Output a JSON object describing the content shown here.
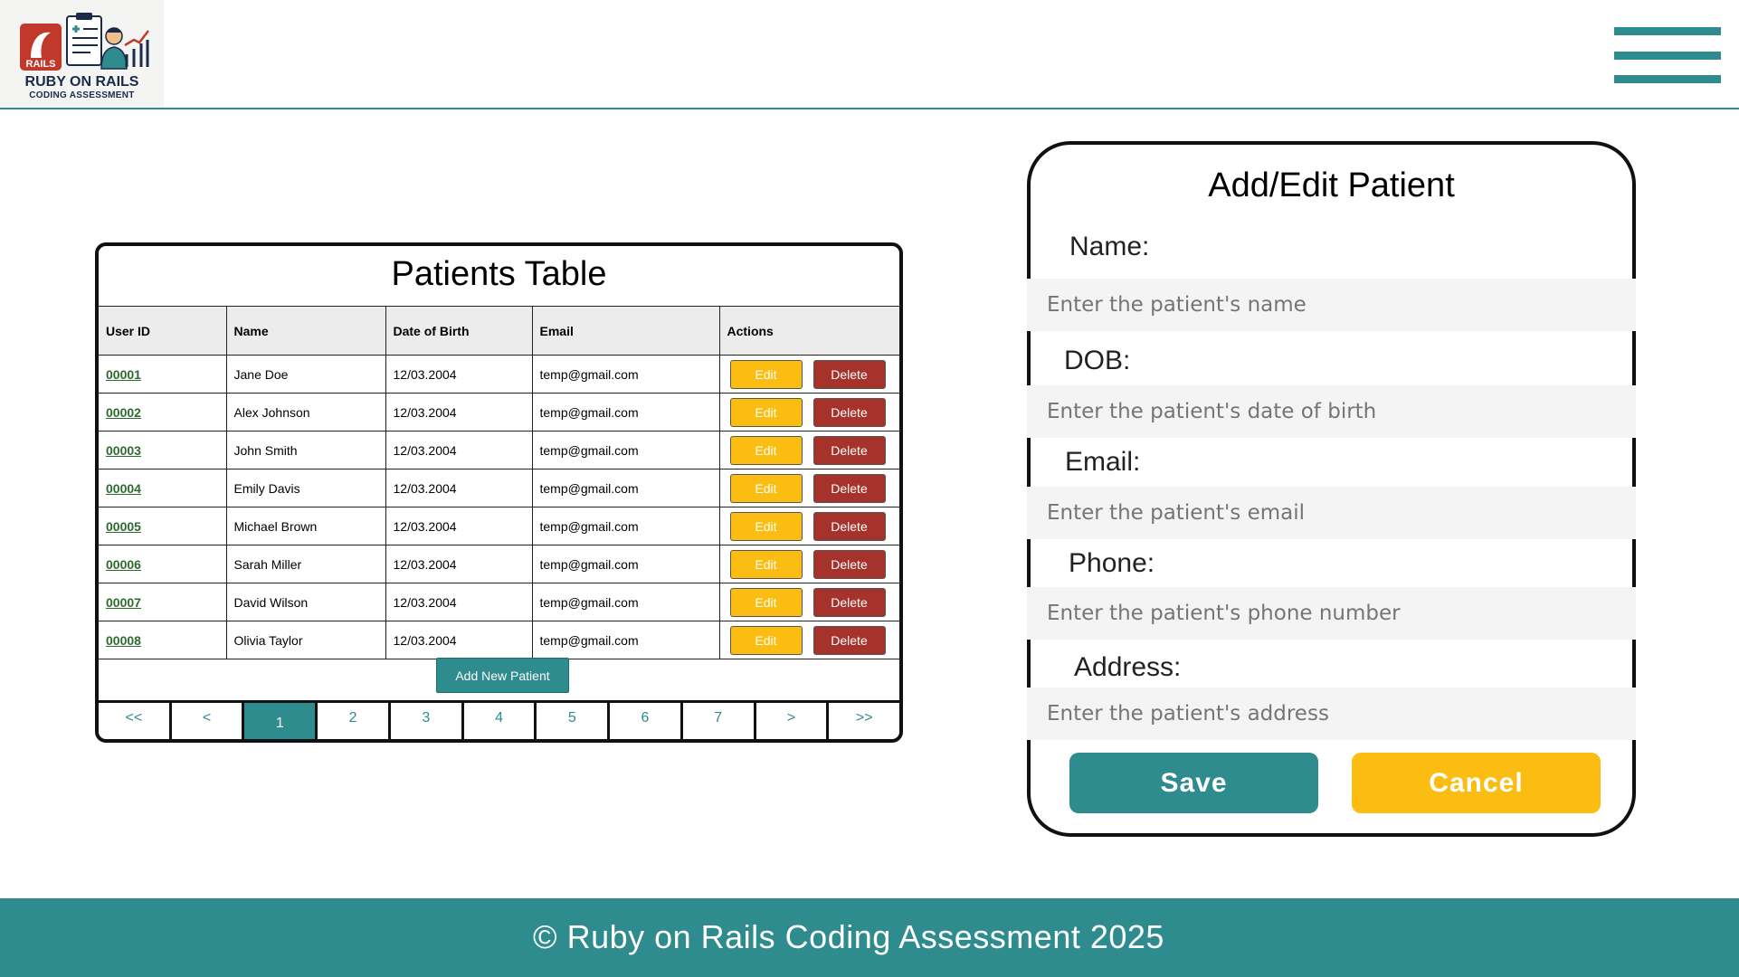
{
  "header": {
    "logo_badge": "RAILS",
    "logo_title": "RUBY ON RAILS",
    "logo_subtitle": "CODING ASSESSMENT",
    "menu_icon": "hamburger-menu-icon"
  },
  "table": {
    "title": "Patients Table",
    "columns": [
      "User ID",
      "Name",
      "Date of Birth",
      "Email",
      "Actions"
    ],
    "edit_label": "Edit",
    "delete_label": "Delete",
    "rows": [
      {
        "id": "00001",
        "name": "Jane Doe",
        "dob": "12/03.2004",
        "email": "temp@gmail.com"
      },
      {
        "id": "00002",
        "name": "Alex Johnson",
        "dob": "12/03.2004",
        "email": "temp@gmail.com"
      },
      {
        "id": "00003",
        "name": "John Smith",
        "dob": "12/03.2004",
        "email": "temp@gmail.com"
      },
      {
        "id": "00004",
        "name": "Emily Davis",
        "dob": "12/03.2004",
        "email": "temp@gmail.com"
      },
      {
        "id": "00005",
        "name": "Michael Brown",
        "dob": "12/03.2004",
        "email": "temp@gmail.com"
      },
      {
        "id": "00006",
        "name": "Sarah Miller",
        "dob": "12/03.2004",
        "email": "temp@gmail.com"
      },
      {
        "id": "00007",
        "name": "David Wilson",
        "dob": "12/03.2004",
        "email": "temp@gmail.com"
      },
      {
        "id": "00008",
        "name": "Olivia Taylor",
        "dob": "12/03.2004",
        "email": "temp@gmail.com"
      }
    ],
    "add_new_label": "Add New Patient",
    "pagination": {
      "items": [
        "<<",
        "<",
        "1",
        "2",
        "3",
        "4",
        "5",
        "6",
        "7",
        ">",
        ">>"
      ],
      "active": "1"
    }
  },
  "form": {
    "title": "Add/Edit Patient",
    "name_label": "Name:",
    "name_placeholder": "Enter the patient's name",
    "dob_label": "DOB:",
    "dob_placeholder": "Enter the patient's date of birth",
    "email_label": "Email:",
    "email_placeholder": "Enter the patient's email",
    "phone_label": "Phone:",
    "phone_placeholder": "Enter the patient's phone number",
    "address_label": "Address:",
    "address_placeholder": "Enter the patient's address",
    "save_label": "Save",
    "cancel_label": "Cancel"
  },
  "footer": {
    "text": "© Ruby on Rails Coding Assessment 2025"
  },
  "colors": {
    "teal": "#2e8b8e",
    "yellow": "#fbbd12",
    "red": "#a6322c"
  }
}
